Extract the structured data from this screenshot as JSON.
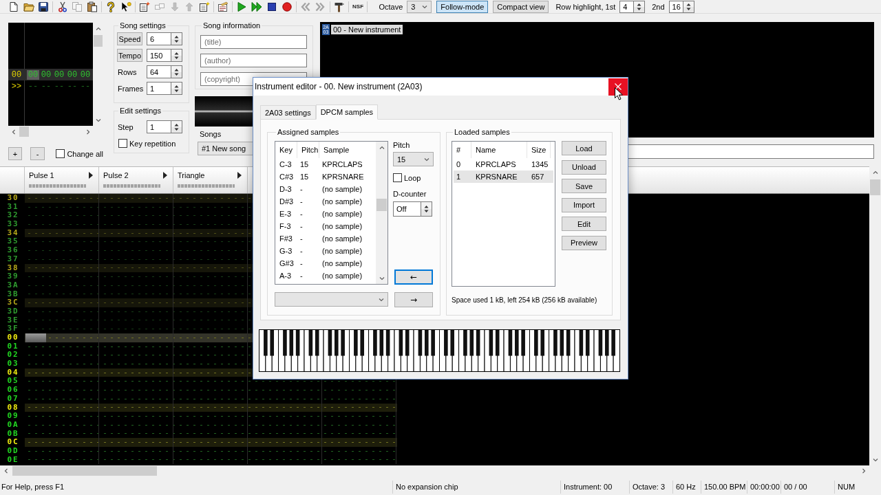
{
  "toolbar": {
    "groups": [
      [
        {
          "kind": "new",
          "disabled": false
        },
        {
          "kind": "open",
          "disabled": false
        },
        {
          "kind": "save",
          "disabled": false
        }
      ],
      [
        {
          "kind": "cut",
          "disabled": false
        },
        {
          "kind": "copy",
          "disabled": true
        },
        {
          "kind": "paste",
          "disabled": false
        }
      ],
      [
        {
          "kind": "help",
          "disabled": false
        },
        {
          "kind": "context-help",
          "disabled": false
        }
      ],
      [
        {
          "kind": "add-frame",
          "disabled": false
        },
        {
          "kind": "remove-frame",
          "disabled": true
        },
        {
          "kind": "move-down",
          "disabled": true
        },
        {
          "kind": "move-up",
          "disabled": true
        },
        {
          "kind": "duplicate-frame",
          "disabled": false
        }
      ],
      [
        {
          "kind": "module-properties",
          "disabled": false
        }
      ],
      [
        {
          "kind": "play",
          "disabled": false
        },
        {
          "kind": "play-pattern",
          "disabled": false
        },
        {
          "kind": "stop",
          "disabled": false
        },
        {
          "kind": "record",
          "disabled": false
        }
      ],
      [
        {
          "kind": "previous-track",
          "disabled": true
        },
        {
          "kind": "next-track",
          "disabled": true
        }
      ],
      [
        {
          "kind": "settings",
          "disabled": false
        }
      ],
      [
        {
          "kind": "export",
          "label": "NSF",
          "disabled": false
        }
      ]
    ],
    "octave": {
      "label": "Octave",
      "value": "3"
    },
    "toggles": [
      {
        "label": "Follow-mode",
        "on": true
      },
      {
        "label": "Compact view",
        "on": false
      }
    ],
    "row_highlight": {
      "label": "Row highlight, 1st",
      "value": "4"
    },
    "second_highlight": {
      "label": "2nd",
      "value": "16"
    }
  },
  "frames": {
    "rows": [
      {
        "number": "00",
        "selected": true,
        "cells": [
          {
            "value": "00",
            "selected": true
          },
          {
            "value": "00",
            "selected": false
          },
          {
            "value": "00",
            "selected": false
          },
          {
            "value": "00",
            "selected": false
          },
          {
            "value": "00",
            "selected": false
          }
        ]
      },
      {
        "number": ">>",
        "selected": false,
        "cells": [
          {
            "value": "--",
            "selected": false
          },
          {
            "value": "--",
            "selected": false
          },
          {
            "value": "--",
            "selected": false
          },
          {
            "value": "--",
            "selected": false
          },
          {
            "value": "--",
            "selected": false
          }
        ]
      }
    ],
    "buttons": [
      "+",
      "-"
    ],
    "change_all": {
      "label": "Change all",
      "checked": false
    }
  },
  "song_settings": {
    "title": "Song settings",
    "fields": [
      {
        "kind": "button",
        "label": "Speed",
        "value": "6"
      },
      {
        "kind": "button",
        "label": "Tempo",
        "value": "150"
      },
      {
        "kind": "label",
        "label": "Rows",
        "value": "64"
      },
      {
        "kind": "label",
        "label": "Frames",
        "value": "1"
      }
    ]
  },
  "edit_settings": {
    "title": "Edit settings",
    "step": {
      "label": "Step",
      "value": "1"
    },
    "key_repetition": {
      "label": "Key repetition",
      "checked": false
    }
  },
  "song_information": {
    "title": "Song information",
    "fields": [
      {
        "placeholder": "(title)"
      },
      {
        "placeholder": "(author)"
      },
      {
        "placeholder": "(copyright)"
      }
    ]
  },
  "songs": {
    "label": "Songs",
    "value": "#1 New song"
  },
  "instruments": {
    "items": [
      {
        "chip": "2A03",
        "name": "00 - New instrument",
        "selected": true
      }
    ]
  },
  "pattern": {
    "channels": [
      {
        "name": "Pulse 1"
      },
      {
        "name": "Pulse 2"
      },
      {
        "name": "Triangle"
      }
    ],
    "sections": [
      {
        "kind": "previous",
        "rows": [
          {
            "number": "30",
            "highlight": true,
            "selected": false
          },
          {
            "number": "31",
            "highlight": false,
            "selected": false
          },
          {
            "number": "32",
            "highlight": false,
            "selected": false
          },
          {
            "number": "33",
            "highlight": false,
            "selected": false
          },
          {
            "number": "34",
            "highlight": true,
            "selected": false
          },
          {
            "number": "35",
            "highlight": false,
            "selected": false
          },
          {
            "number": "36",
            "highlight": false,
            "selected": false
          },
          {
            "number": "37",
            "highlight": false,
            "selected": false
          },
          {
            "number": "38",
            "highlight": true,
            "selected": false
          },
          {
            "number": "39",
            "highlight": false,
            "selected": false
          },
          {
            "number": "3A",
            "highlight": false,
            "selected": false
          },
          {
            "number": "3B",
            "highlight": false,
            "selected": false
          },
          {
            "number": "3C",
            "highlight": true,
            "selected": false
          },
          {
            "number": "3D",
            "highlight": false,
            "selected": false
          },
          {
            "number": "3E",
            "highlight": false,
            "selected": false
          },
          {
            "number": "3F",
            "highlight": false,
            "selected": false
          }
        ]
      },
      {
        "kind": "current",
        "rows": [
          {
            "number": "00",
            "highlight": true,
            "selected": true
          },
          {
            "number": "01",
            "highlight": false,
            "selected": false
          },
          {
            "number": "02",
            "highlight": false,
            "selected": false
          },
          {
            "number": "03",
            "highlight": false,
            "selected": false
          },
          {
            "number": "04",
            "highlight": true,
            "selected": false
          },
          {
            "number": "05",
            "highlight": false,
            "selected": false
          },
          {
            "number": "06",
            "highlight": false,
            "selected": false
          },
          {
            "number": "07",
            "highlight": false,
            "selected": false
          },
          {
            "number": "08",
            "highlight": true,
            "selected": false
          },
          {
            "number": "09",
            "highlight": false,
            "selected": false
          },
          {
            "number": "0A",
            "highlight": false,
            "selected": false
          },
          {
            "number": "0B",
            "highlight": false,
            "selected": false
          },
          {
            "number": "0C",
            "highlight": true,
            "selected": false
          },
          {
            "number": "0D",
            "highlight": false,
            "selected": false
          },
          {
            "number": "0E",
            "highlight": false,
            "selected": false
          }
        ]
      }
    ]
  },
  "instrument_editor": {
    "title": "Instrument editor - 00. New instrument (2A03)",
    "tabs": [
      {
        "label": "2A03 settings",
        "selected": false
      },
      {
        "label": "DPCM samples",
        "selected": true
      }
    ],
    "assigned_samples": {
      "title": "Assigned samples",
      "columns": [
        "Key",
        "Pitch",
        "Sample"
      ],
      "rows": [
        {
          "key": "C-3",
          "pitch": "15",
          "sample": "KPRCLAPS"
        },
        {
          "key": "C#3",
          "pitch": "15",
          "sample": "KPRSNARE"
        },
        {
          "key": "D-3",
          "pitch": "-",
          "sample": "(no sample)"
        },
        {
          "key": "D#3",
          "pitch": "-",
          "sample": "(no sample)"
        },
        {
          "key": "E-3",
          "pitch": "-",
          "sample": "(no sample)"
        },
        {
          "key": "F-3",
          "pitch": "-",
          "sample": "(no sample)"
        },
        {
          "key": "F#3",
          "pitch": "-",
          "sample": "(no sample)"
        },
        {
          "key": "G-3",
          "pitch": "-",
          "sample": "(no sample)"
        },
        {
          "key": "G#3",
          "pitch": "-",
          "sample": "(no sample)"
        },
        {
          "key": "A-3",
          "pitch": "-",
          "sample": "(no sample)"
        }
      ]
    },
    "pitch": {
      "label": "Pitch",
      "value": "15"
    },
    "loop": {
      "label": "Loop",
      "checked": false
    },
    "d_counter": {
      "label": "D-counter",
      "value": "Off"
    },
    "assign_buttons": [
      {
        "label": "←",
        "focused": true
      },
      {
        "label": "→",
        "focused": false
      }
    ],
    "loaded_samples": {
      "title": "Loaded samples",
      "columns": [
        "#",
        "Name",
        "Size"
      ],
      "rows": [
        {
          "index": "0",
          "name": "KPRCLAPS",
          "size": "1345",
          "selected": false
        },
        {
          "index": "1",
          "name": "KPRSNARE",
          "size": "657",
          "selected": true
        }
      ],
      "buttons": [
        "Load",
        "Unload",
        "Save",
        "Import",
        "Edit",
        "Preview"
      ],
      "space_info": "Space used 1 kB, left 254 kB (256 kB available)"
    }
  },
  "status_bar": [
    "For Help, press F1",
    "No expansion chip",
    "Instrument: 00",
    "Octave: 3",
    "60 Hz",
    "150.00 BPM",
    "00:00:00",
    "00 / 00",
    "NUM"
  ]
}
